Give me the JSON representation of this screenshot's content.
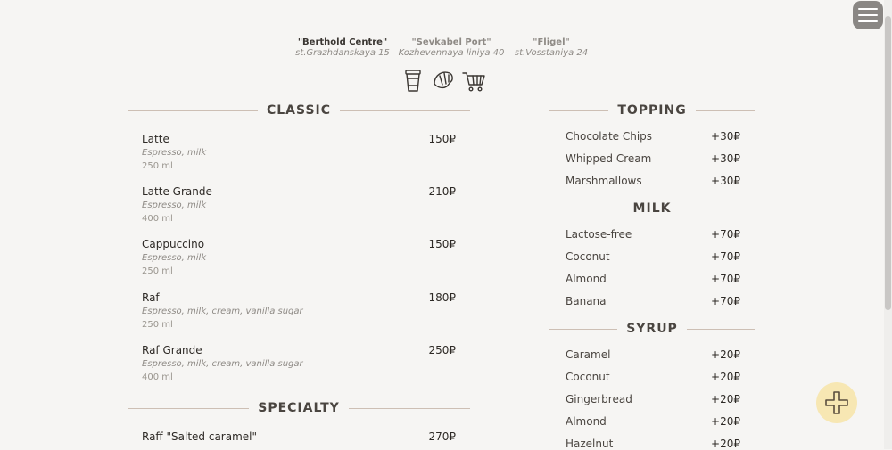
{
  "locations": [
    {
      "name": "\"Berthold Centre\"",
      "address": "st.Grazhdanskaya 15"
    },
    {
      "name": "\"Sevkabel Port\"",
      "address": "Kozhevennaya liniya 40"
    },
    {
      "name": "\"Fligel\"",
      "address": "st.Vosstaniya 24"
    }
  ],
  "sections": {
    "classic": "CLASSIC",
    "specialty": "SPECIALTY",
    "topping": "TOPPING",
    "milk": "MILK",
    "syrup": "SYRUP"
  },
  "classic_items": [
    {
      "name": "Latte",
      "price": "150₽",
      "desc": "Espresso, milk",
      "volume": "250 ml"
    },
    {
      "name": "Latte Grande",
      "price": "210₽",
      "desc": "Espresso, milk",
      "volume": "400 ml"
    },
    {
      "name": "Cappuccino",
      "price": "150₽",
      "desc": "Espresso, milk",
      "volume": "250 ml"
    },
    {
      "name": "Raf",
      "price": "180₽",
      "desc": "Espresso, milk, cream, vanilla sugar",
      "volume": "250 ml"
    },
    {
      "name": "Raf Grande",
      "price": "250₽",
      "desc": "Espresso, milk, cream, vanilla sugar",
      "volume": "400 ml"
    }
  ],
  "specialty_items": [
    {
      "name": "Raff \"Salted caramel\"",
      "price": "270₽"
    }
  ],
  "toppings": [
    {
      "name": "Chocolate Chips",
      "price": "+30₽"
    },
    {
      "name": "Whipped Cream",
      "price": "+30₽"
    },
    {
      "name": "Marshmallows",
      "price": "+30₽"
    }
  ],
  "milk": [
    {
      "name": "Lactose-free",
      "price": "+70₽"
    },
    {
      "name": "Coconut",
      "price": "+70₽"
    },
    {
      "name": "Almond",
      "price": "+70₽"
    },
    {
      "name": "Banana",
      "price": "+70₽"
    }
  ],
  "syrup": [
    {
      "name": "Caramel",
      "price": "+20₽"
    },
    {
      "name": "Coconut",
      "price": "+20₽"
    },
    {
      "name": "Gingerbread",
      "price": "+20₽"
    },
    {
      "name": "Almond",
      "price": "+20₽"
    },
    {
      "name": "Hazelnut",
      "price": "+20₽"
    }
  ],
  "icons": [
    "coffee-cup-icon",
    "croissant-icon",
    "cart-icon",
    "menu-icon",
    "plus-icon"
  ],
  "colors": {
    "background": "#f6f5f3",
    "text": "#2e2a26",
    "muted": "#8e8a85",
    "divider": "#cdbfb4",
    "fab": "#f7e7b3",
    "menu_button": "#8a8784"
  }
}
